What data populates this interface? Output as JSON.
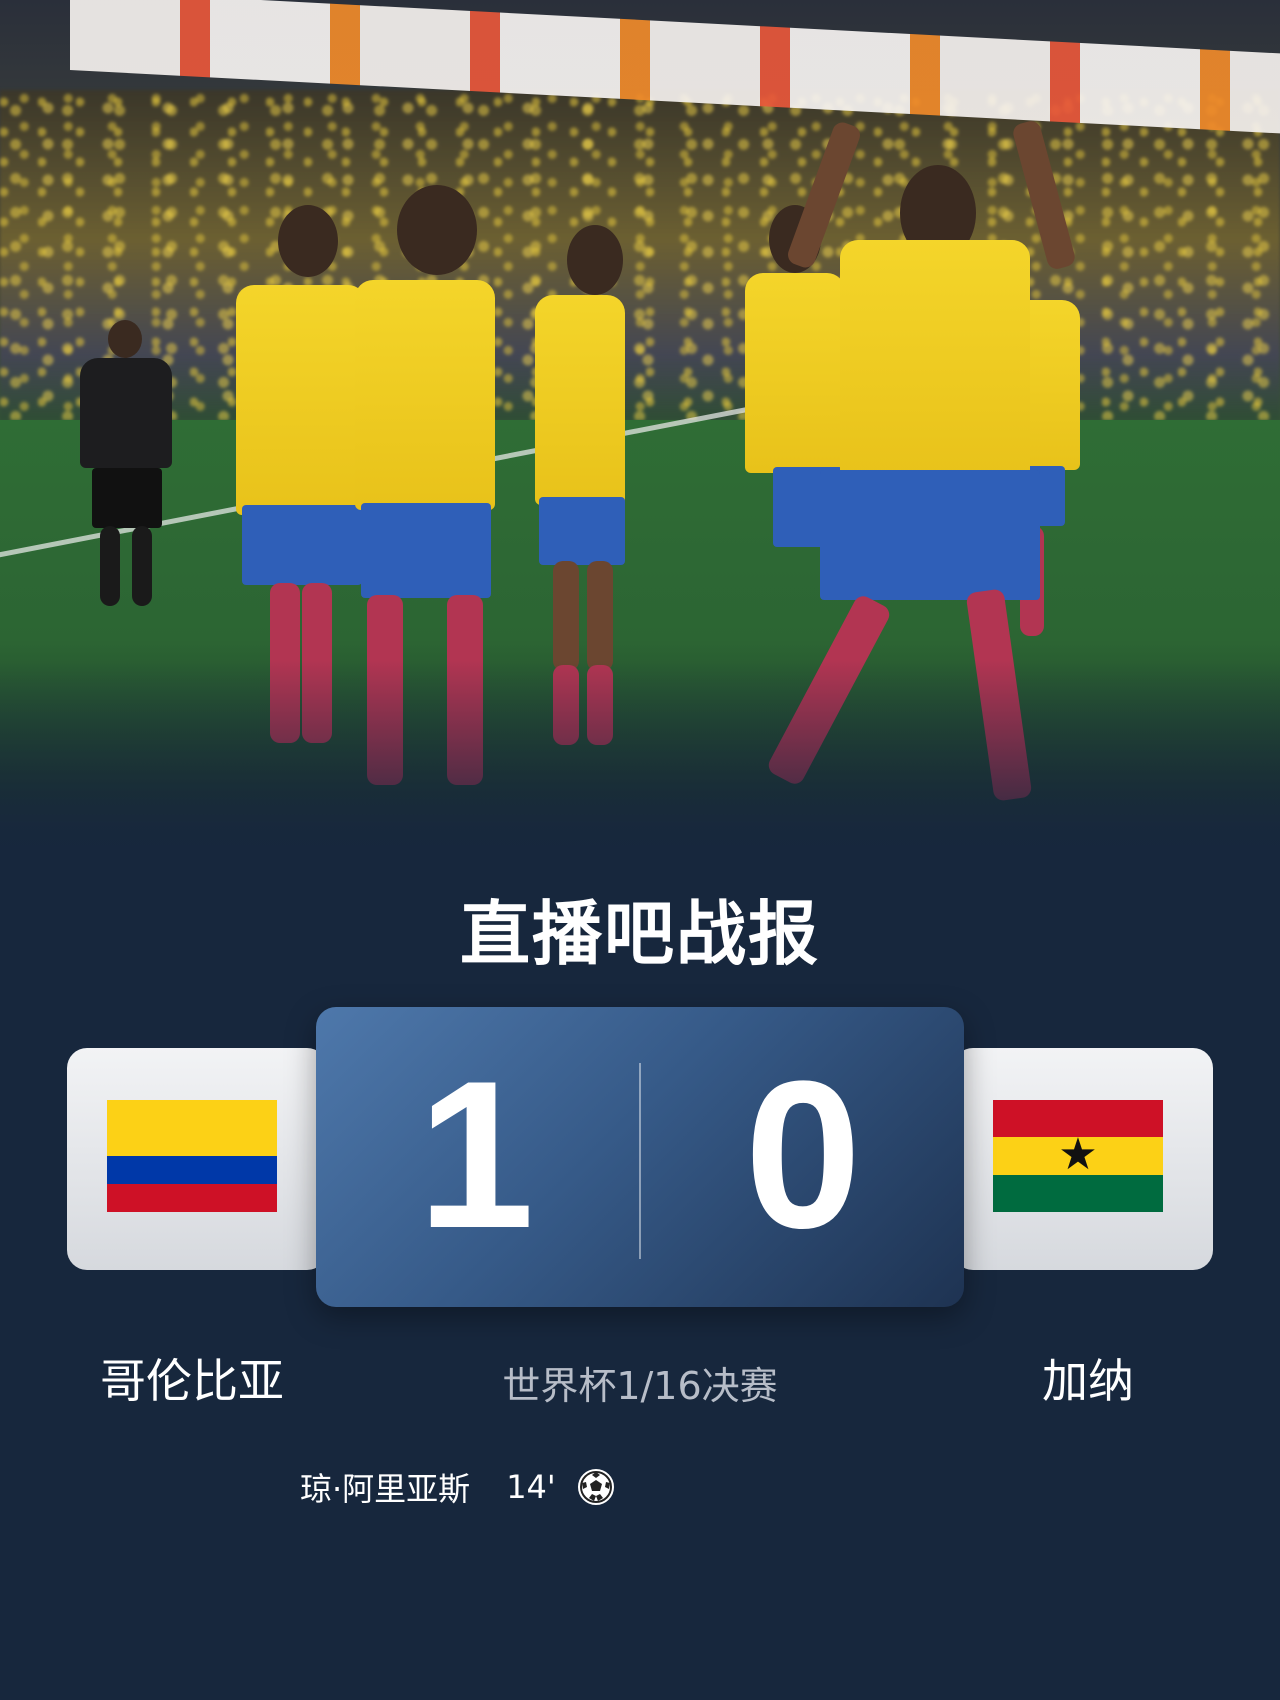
{
  "report": {
    "brand_title": "直播吧战报",
    "competition": "世界杯1/16决赛"
  },
  "home": {
    "name": "哥伦比亚",
    "score": "1",
    "flag": "colombia-flag"
  },
  "away": {
    "name": "加纳",
    "score": "0",
    "flag": "ghana-flag"
  },
  "events": [
    {
      "player": "琼·阿里亚斯",
      "minute": "14'",
      "type": "goal",
      "icon": "soccer-ball-icon"
    }
  ],
  "colors": {
    "background": "#17273d",
    "score_box": "#365a88",
    "accent": "#3fd6c4"
  }
}
